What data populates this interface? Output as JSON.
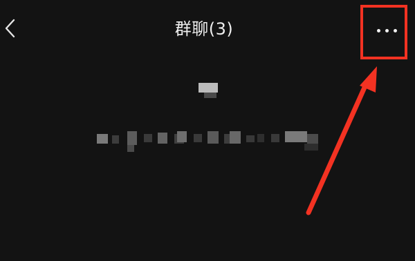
{
  "header": {
    "title": "群聊(3)",
    "back_icon": "chevron-left-icon",
    "more_icon": "more-horizontal-icon"
  },
  "annotation": {
    "highlight_color": "#f33222",
    "target": "more-button"
  },
  "colors": {
    "background": "#131313",
    "text": "#eeeeee",
    "annotation": "#f33222"
  }
}
